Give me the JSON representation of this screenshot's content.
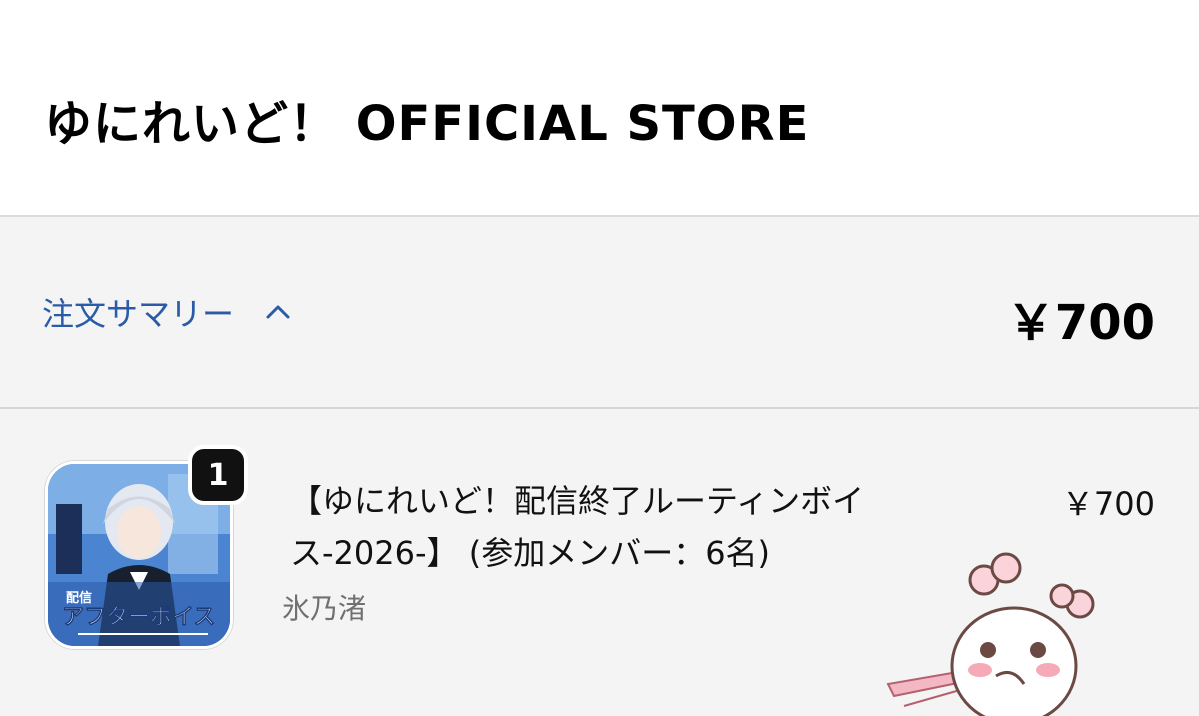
{
  "header": {
    "store_name": "ゆにれいど！ OFFICIAL STORE"
  },
  "summary": {
    "label": "注文サマリー",
    "toggle_icon": "chevron-up-icon",
    "total": "￥700",
    "link_color": "#2a5ba8"
  },
  "line_item": {
    "quantity": "1",
    "title": "【ゆにれいど！配信終了ルーティンボイス-2026-】 (参加メンバー：6名)",
    "price": "￥700",
    "vendor": "氷乃渚",
    "thumbnail_text_small": "配信",
    "thumbnail_text": "アフターボイス"
  }
}
